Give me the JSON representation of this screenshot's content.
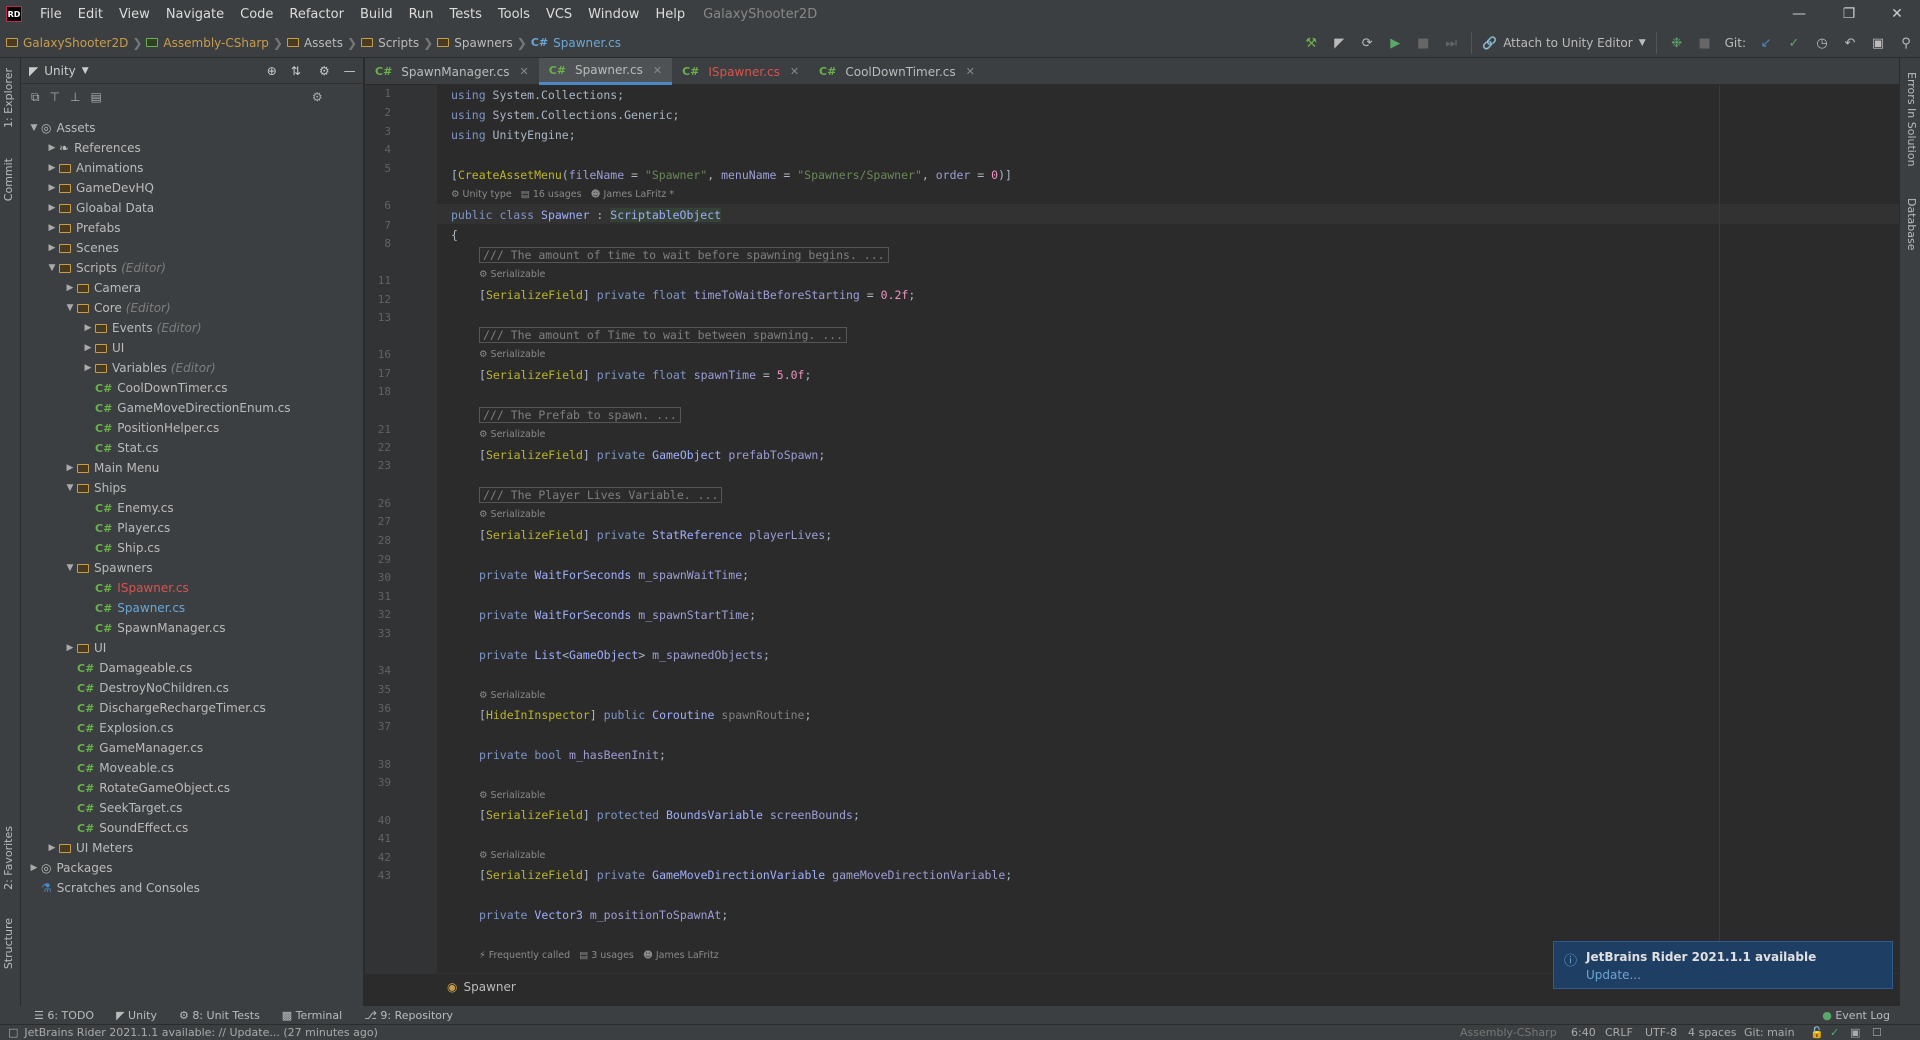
{
  "menu": {
    "logo": "RD",
    "items": [
      "File",
      "Edit",
      "View",
      "Navigate",
      "Code",
      "Refactor",
      "Build",
      "Run",
      "Tests",
      "Tools",
      "VCS",
      "Window",
      "Help"
    ],
    "project": "GalaxyShooter2D"
  },
  "nav": {
    "crumbs": [
      "GalaxyShooter2D",
      "Assembly-CSharp",
      "Assets",
      "Scripts",
      "Spawners",
      "Spawner.cs"
    ],
    "attach_label": "Attach to Unity Editor",
    "git_label": "Git:"
  },
  "explorer": {
    "title": "Unity",
    "tree": [
      {
        "label": "Assets",
        "depth": 0,
        "kind": "assets",
        "open": true
      },
      {
        "label": "References",
        "depth": 1,
        "kind": "ref",
        "open": false
      },
      {
        "label": "Animations",
        "depth": 1,
        "kind": "folder",
        "open": false
      },
      {
        "label": "GameDevHQ",
        "depth": 1,
        "kind": "folder",
        "open": false
      },
      {
        "label": "Gloabal Data",
        "depth": 1,
        "kind": "folder",
        "open": false
      },
      {
        "label": "Prefabs",
        "depth": 1,
        "kind": "folder",
        "open": false
      },
      {
        "label": "Scenes",
        "depth": 1,
        "kind": "folder",
        "open": false
      },
      {
        "label": "Scripts",
        "depth": 1,
        "kind": "folder",
        "open": true,
        "note": "(Editor)"
      },
      {
        "label": "Camera",
        "depth": 2,
        "kind": "folder",
        "open": false
      },
      {
        "label": "Core",
        "depth": 2,
        "kind": "folder",
        "open": true,
        "note": "(Editor)"
      },
      {
        "label": "Events",
        "depth": 3,
        "kind": "folder",
        "open": false,
        "note": "(Editor)"
      },
      {
        "label": "UI",
        "depth": 3,
        "kind": "folder",
        "open": false
      },
      {
        "label": "Variables",
        "depth": 3,
        "kind": "folder",
        "open": false,
        "note": "(Editor)"
      },
      {
        "label": "CoolDownTimer.cs",
        "depth": 3,
        "kind": "cs"
      },
      {
        "label": "GameMoveDirectionEnum.cs",
        "depth": 3,
        "kind": "cs"
      },
      {
        "label": "PositionHelper.cs",
        "depth": 3,
        "kind": "cs"
      },
      {
        "label": "Stat.cs",
        "depth": 3,
        "kind": "cs"
      },
      {
        "label": "Main Menu",
        "depth": 2,
        "kind": "folder",
        "open": false
      },
      {
        "label": "Ships",
        "depth": 2,
        "kind": "folder",
        "open": true
      },
      {
        "label": "Enemy.cs",
        "depth": 3,
        "kind": "cs"
      },
      {
        "label": "Player.cs",
        "depth": 3,
        "kind": "cs"
      },
      {
        "label": "Ship.cs",
        "depth": 3,
        "kind": "cs"
      },
      {
        "label": "Spawners",
        "depth": 2,
        "kind": "folder",
        "open": true
      },
      {
        "label": "ISpawner.cs",
        "depth": 3,
        "kind": "cs",
        "state": "err"
      },
      {
        "label": "Spawner.cs",
        "depth": 3,
        "kind": "cs",
        "state": "sel"
      },
      {
        "label": "SpawnManager.cs",
        "depth": 3,
        "kind": "cs"
      },
      {
        "label": "UI",
        "depth": 2,
        "kind": "folder",
        "open": false
      },
      {
        "label": "Damageable.cs",
        "depth": 2,
        "kind": "cs"
      },
      {
        "label": "DestroyNoChildren.cs",
        "depth": 2,
        "kind": "cs"
      },
      {
        "label": "DischargeRechargeTimer.cs",
        "depth": 2,
        "kind": "cs"
      },
      {
        "label": "Explosion.cs",
        "depth": 2,
        "kind": "cs"
      },
      {
        "label": "GameManager.cs",
        "depth": 2,
        "kind": "cs"
      },
      {
        "label": "Moveable.cs",
        "depth": 2,
        "kind": "cs"
      },
      {
        "label": "RotateGameObject.cs",
        "depth": 2,
        "kind": "cs"
      },
      {
        "label": "SeekTarget.cs",
        "depth": 2,
        "kind": "cs"
      },
      {
        "label": "SoundEffect.cs",
        "depth": 2,
        "kind": "cs"
      },
      {
        "label": "UI Meters",
        "depth": 1,
        "kind": "folder",
        "open": false
      },
      {
        "label": "Packages",
        "depth": 0,
        "kind": "pkg",
        "open": false
      },
      {
        "label": "Scratches and Consoles",
        "depth": 0,
        "kind": "scratch"
      }
    ]
  },
  "tabs": [
    {
      "label": "SpawnManager.cs",
      "active": false,
      "err": false
    },
    {
      "label": "Spawner.cs",
      "active": true,
      "err": false
    },
    {
      "label": "ISpawner.cs",
      "active": false,
      "err": true
    },
    {
      "label": "CoolDownTimer.cs",
      "active": false,
      "err": false
    }
  ],
  "code": {
    "line_numbers": [
      "1",
      "2",
      "3",
      "4",
      "5",
      "6",
      "7",
      "8",
      "11",
      "12",
      "13",
      "16",
      "17",
      "18",
      "21",
      "22",
      "23",
      "26",
      "27",
      "28",
      "29",
      "30",
      "31",
      "32",
      "33",
      "34",
      "35",
      "36",
      "37",
      "38",
      "39",
      "40",
      "41",
      "42",
      "43"
    ],
    "hint_unity": "Unity type",
    "hint_usages": "16 usages",
    "hint_author": "James LaFritz *",
    "hint_serializable": "Serializable",
    "hint_freq": "Frequently called",
    "hint_usages2": "3 usages",
    "hint_author2": "James LaFritz",
    "structure_crumb": "Spawner"
  },
  "toolwindows": [
    "6: TODO",
    "Unity",
    "8: Unit Tests",
    "Terminal",
    "9: Repository"
  ],
  "event_log": "Event Log",
  "left_tabs": [
    "1: Explorer",
    "Commit",
    "2: Favorites",
    "Structure"
  ],
  "right_tabs": [
    "Errors In Solution",
    "Database"
  ],
  "notification": {
    "title": "JetBrains Rider 2021.1.1 available",
    "link": "Update..."
  },
  "status": {
    "message": "JetBrains Rider 2021.1.1 available: // Update... (27 minutes ago)",
    "context": "Assembly-CSharp",
    "position": "6:40",
    "line_sep": "CRLF",
    "encoding": "UTF-8",
    "indent": "4 spaces",
    "branch": "Git: main"
  }
}
